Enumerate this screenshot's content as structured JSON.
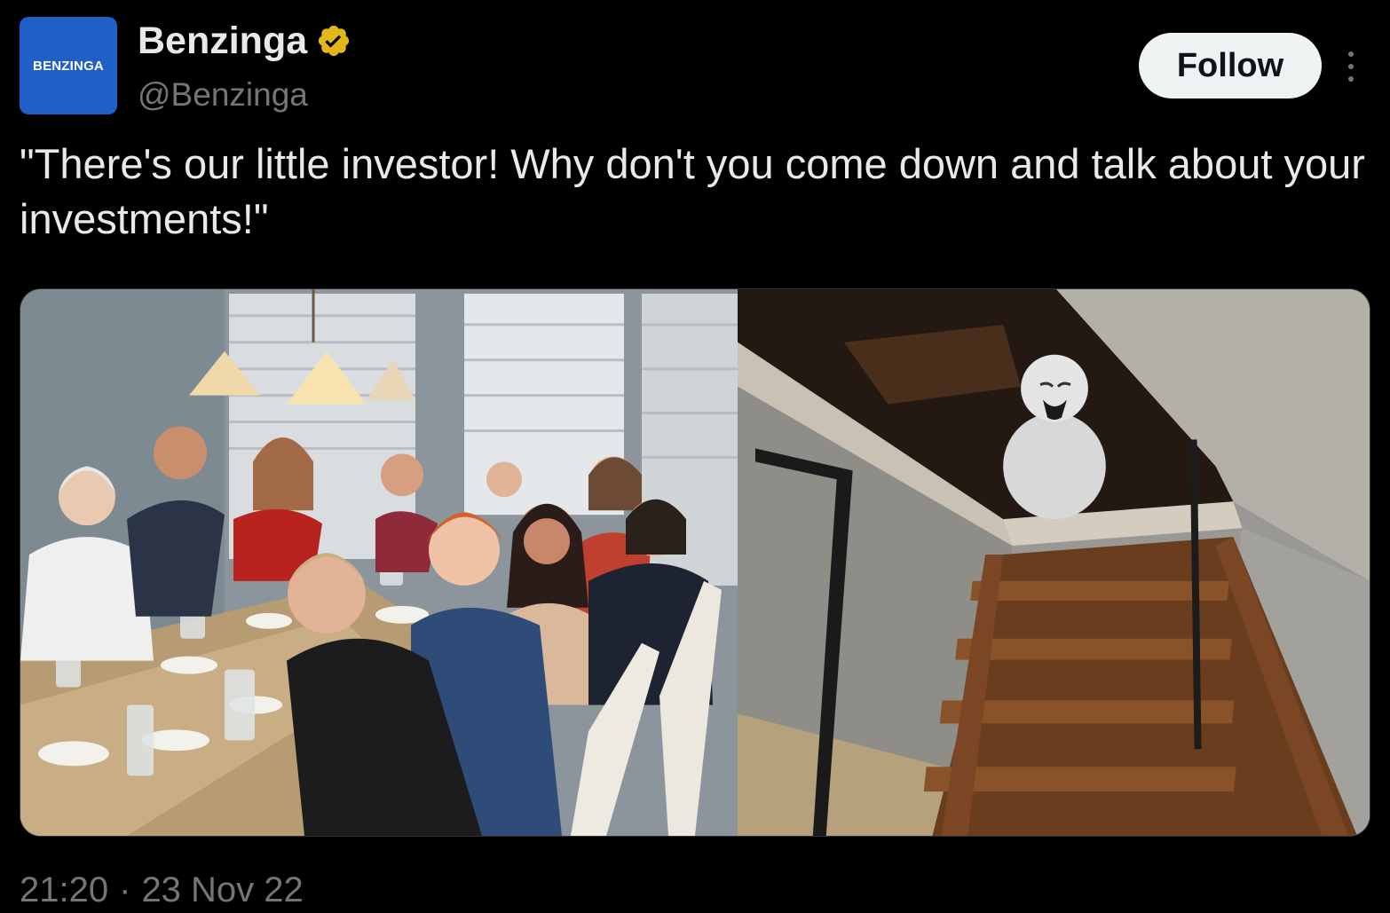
{
  "author": {
    "avatar_text": "BENZINGA",
    "display_name": "Benzinga",
    "handle": "@Benzinga",
    "verified_icon": "verified-badge-icon",
    "verified_color": "#e2b719"
  },
  "actions": {
    "follow_label": "Follow",
    "more_icon": "more-options-icon"
  },
  "tweet": {
    "text": "\"There's our little investor! Why don't you come down and talk about your investments!\""
  },
  "media": {
    "left_image": "family-dinner-photo",
    "right_image": "attic-stairs-meme-figure"
  },
  "meta": {
    "time": "21:20",
    "separator": "·",
    "date": "23 Nov 22"
  },
  "colors": {
    "background": "#000000",
    "primary_text": "#e7e9ea",
    "secondary_text": "#71767b",
    "avatar_bg": "#1f5fc7",
    "follow_bg": "#eff3f4"
  }
}
